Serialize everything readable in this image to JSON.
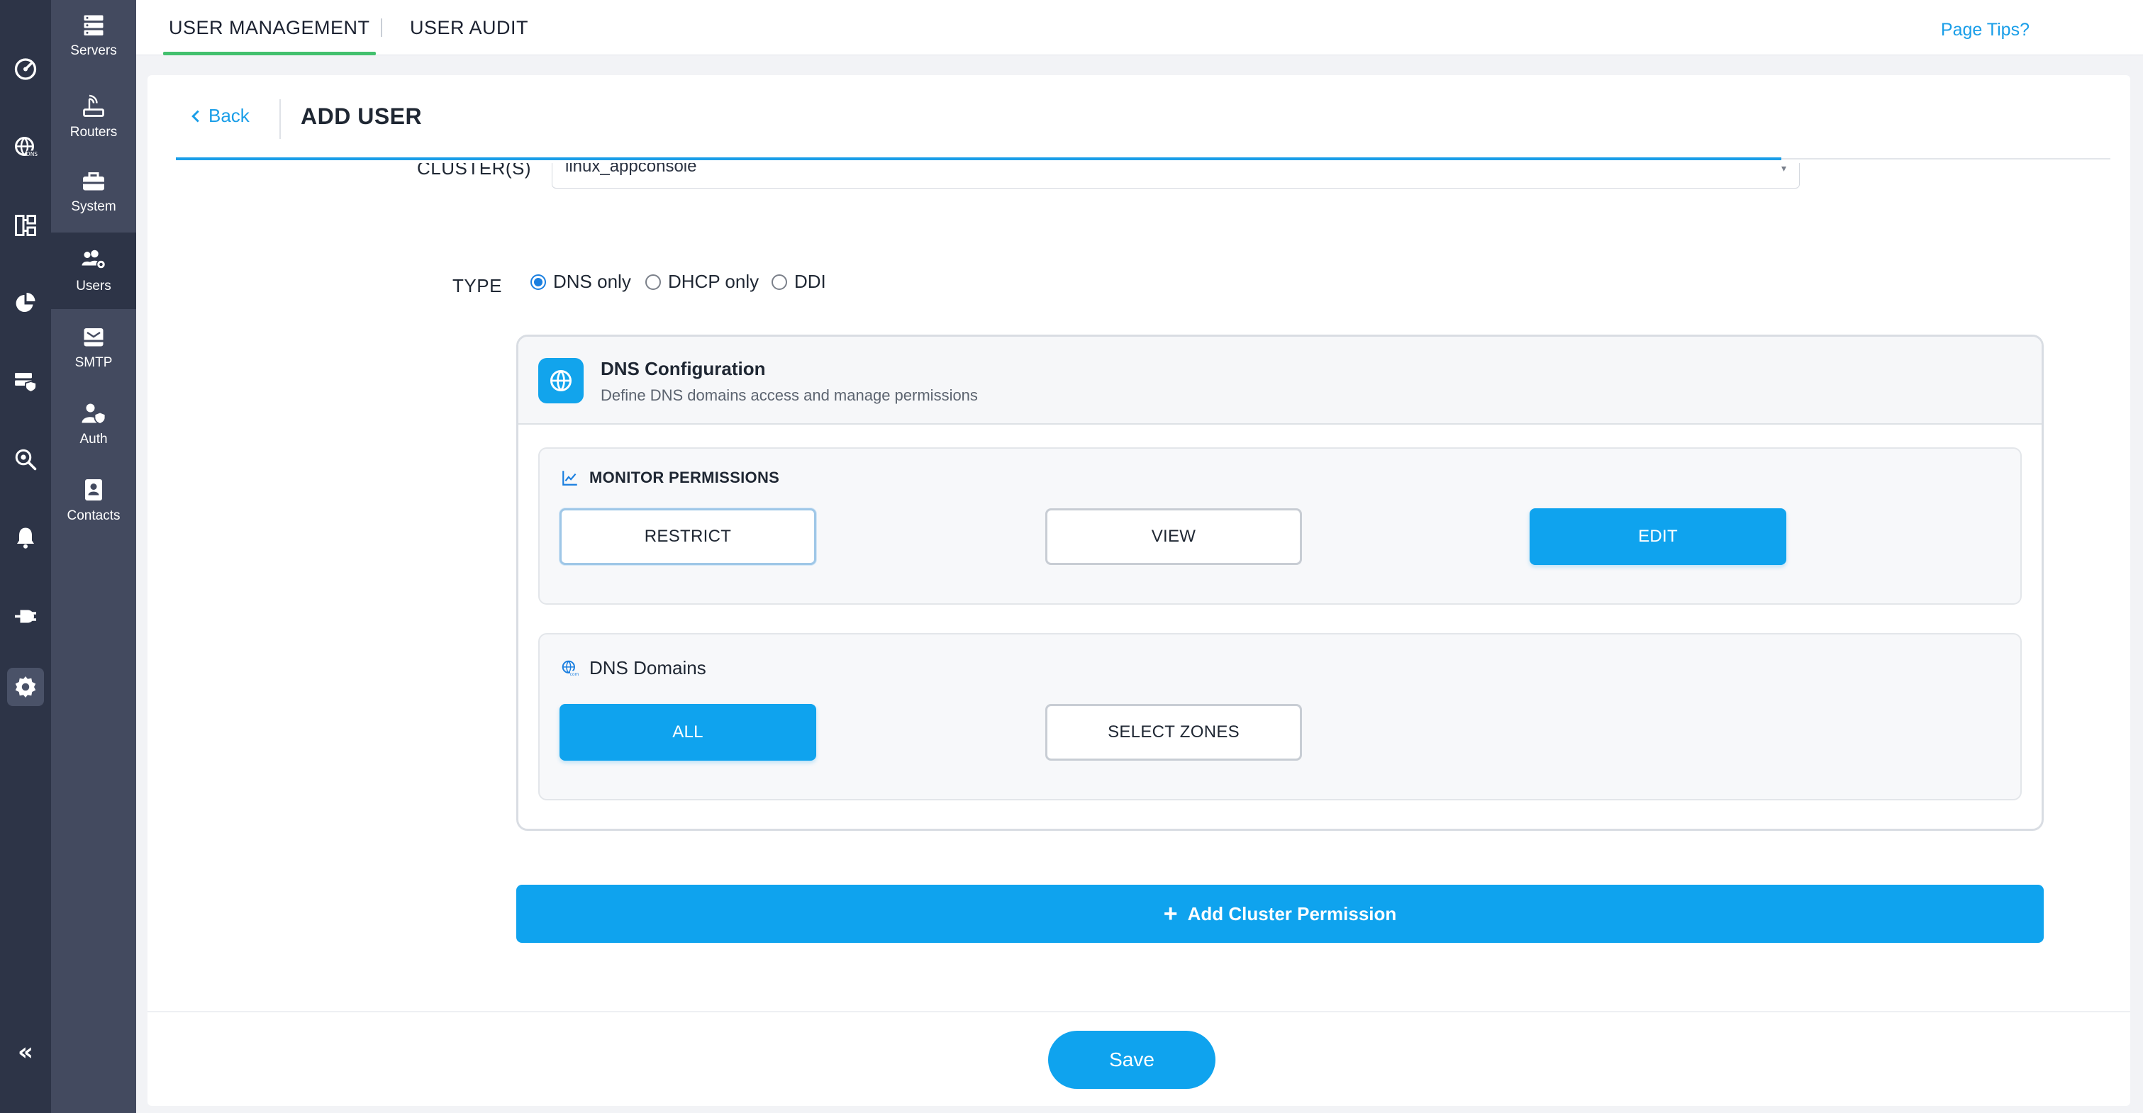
{
  "rail": {
    "icons": [
      "dashboard-gauge-icon",
      "dns-globe-icon",
      "network-topology-icon",
      "analytics-pie-icon",
      "server-security-icon",
      "search-bug-icon",
      "notifications-bell-icon",
      "plugin-plug-icon",
      "settings-gear-icon"
    ],
    "active": "settings-gear-icon",
    "collapse_glyph": "«"
  },
  "subnav": {
    "items": [
      {
        "label": "Servers",
        "icon": "servers-icon"
      },
      {
        "label": "Routers",
        "icon": "router-icon"
      },
      {
        "label": "System",
        "icon": "toolbox-icon"
      },
      {
        "label": "Users",
        "icon": "users-gear-icon"
      },
      {
        "label": "SMTP",
        "icon": "mail-tray-icon"
      },
      {
        "label": "Auth",
        "icon": "user-shield-icon"
      },
      {
        "label": "Contacts",
        "icon": "contact-book-icon"
      }
    ],
    "active": "Users"
  },
  "tabs": {
    "items": [
      "USER MANAGEMENT",
      "USER AUDIT"
    ],
    "active": "USER MANAGEMENT",
    "page_tips": "Page Tips?"
  },
  "header": {
    "back_label": "Back",
    "title": "ADD USER"
  },
  "form": {
    "cluster_label": "CLUSTER(S)",
    "cluster_value": "linux_appconsole",
    "type_label": "TYPE",
    "type_options": [
      "DNS only",
      "DHCP only",
      "DDI"
    ],
    "type_selected": "DNS only"
  },
  "dns_config": {
    "title": "DNS Configuration",
    "subtitle": "Define DNS domains access and manage permissions",
    "monitor": {
      "title": "MONITOR PERMISSIONS",
      "options": [
        "RESTRICT",
        "VIEW",
        "EDIT"
      ],
      "selected": "EDIT"
    },
    "domains": {
      "title": "DNS Domains",
      "options": [
        "ALL",
        "SELECT ZONES"
      ],
      "selected": "ALL"
    }
  },
  "actions": {
    "add_cluster_label": "Add Cluster Permission",
    "save_label": "Save"
  },
  "colors": {
    "accent": "#0fa3ee",
    "tab_underline": "#43c06e",
    "rail_bg": "#2d3447",
    "subnav_bg": "#434a5f"
  }
}
